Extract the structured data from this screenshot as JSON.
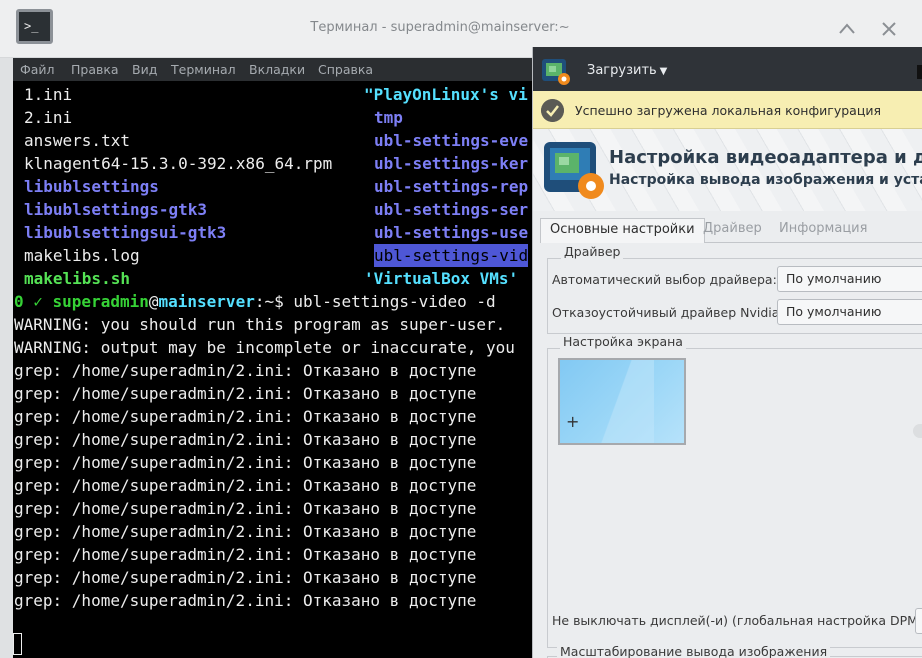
{
  "terminal": {
    "title": "Терминал - superadmin@mainserver:~",
    "menu": [
      "Файл",
      "Правка",
      "Вид",
      "Терминал",
      "Вкладки",
      "Справка"
    ],
    "listing_left": [
      "1.ini",
      "2.ini",
      "answers.txt",
      "klnagent64-15.3.0-392.x86_64.rpm",
      "libublsettings",
      "libublsettings-gtk3",
      "libublsettingsui-gtk3",
      "makelibs.log",
      "makelibs.sh"
    ],
    "listing_right": [
      "\"PlayOnLinux's vi",
      "tmp",
      "ubl-settings-eve",
      "ubl-settings-ker",
      "ubl-settings-rep",
      "ubl-settings-ser",
      "ubl-settings-use",
      "ubl-settings-vid",
      "'VirtualBox VMs'"
    ],
    "prompt": {
      "status": "0 ✓ ",
      "user": "superadmin",
      "at": "@",
      "host": "mainserver",
      "path": ":~$ ",
      "command": "ubl-settings-video -d"
    },
    "output": [
      "WARNING: you should run this program as super-user.",
      "WARNING: output may be incomplete or inaccurate, you",
      "grep: /home/superadmin/2.ini: Отказано в доступе",
      "grep: /home/superadmin/2.ini: Отказано в доступе",
      "grep: /home/superadmin/2.ini: Отказано в доступе",
      "grep: /home/superadmin/2.ini: Отказано в доступе",
      "grep: /home/superadmin/2.ini: Отказано в доступе",
      "grep: /home/superadmin/2.ini: Отказано в доступе",
      "grep: /home/superadmin/2.ini: Отказано в доступе",
      "grep: /home/superadmin/2.ini: Отказано в доступе",
      "grep: /home/superadmin/2.ini: Отказано в доступе",
      "grep: /home/superadmin/2.ini: Отказано в доступе",
      "grep: /home/superadmin/2.ini: Отказано в доступе"
    ]
  },
  "video_settings": {
    "load_label": "Загрузить",
    "info_text": "Успешно загружена локальная конфигурация",
    "banner_title": "Настройка видеоадаптера и дисп",
    "banner_subtitle": "Настройка вывода изображения и установ",
    "tabs": [
      "Основные настройки",
      "Драйвер",
      "Информация"
    ],
    "driver_frame_label": "Драйвер",
    "auto_driver_label": "Автоматический выбор драйвера:",
    "auto_driver_value": "По умолчанию",
    "nvidia_label": "Отказоустойчивый драйвер Nvidia:",
    "nvidia_value": "По умолчанию",
    "screen_frame_label": "Настройка экрана",
    "screen_plus": "+",
    "dpms_label": "Не выключать дисплей(-и) (глобальная настройка DPMS):",
    "scale_label": "Масштабирование вывода изображения"
  },
  "colors": {
    "terminal_bg": "#000000",
    "dir": "#7d7ff5",
    "exe": "#55e255",
    "highlight": "#4e57d6",
    "info_bar": "#f7eeb2"
  }
}
